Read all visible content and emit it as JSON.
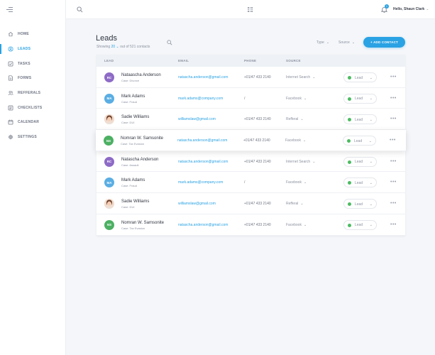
{
  "sidebar": {
    "items": [
      {
        "label": "HOME",
        "icon": "home-icon",
        "active": false
      },
      {
        "label": "LEADS",
        "icon": "user-circle-icon",
        "active": true
      },
      {
        "label": "TASKS",
        "icon": "checkbox-icon",
        "active": false
      },
      {
        "label": "FORMS",
        "icon": "document-icon",
        "active": false
      },
      {
        "label": "REFFERALS",
        "icon": "users-icon",
        "active": false
      },
      {
        "label": "CHECKLISTS",
        "icon": "checklist-icon",
        "active": false
      },
      {
        "label": "CALENDAR",
        "icon": "calendar-icon",
        "active": false
      },
      {
        "label": "SETTINGS",
        "icon": "gear-icon",
        "active": false
      }
    ]
  },
  "topbar": {
    "greeting": "Hello, Shaun Clark",
    "notification_count": "1"
  },
  "page": {
    "title": "Leads",
    "showing_label": "Showing",
    "per_page": "20",
    "total_text": "out of 521 contacts",
    "filters": [
      {
        "label": "Type"
      },
      {
        "label": "Source"
      }
    ],
    "add_contact_label": "+ ADD CONTACT"
  },
  "table": {
    "headers": [
      "LEAD",
      "EMAIL",
      "PHONE",
      "SOURCE"
    ],
    "rows": [
      {
        "initials": "RC",
        "avatar_color": "#8e6bc6",
        "name": "Nataascha Anderson",
        "case": "Case: Divorce",
        "email": "natascha.anderson@gmail.com",
        "phone": "+01/47 433 2140",
        "source": "Internet Search",
        "status": "Lead"
      },
      {
        "initials": "MA",
        "avatar_color": "#5aaee3",
        "name": "Mark Adams",
        "case": "Case: Fraud",
        "email": "mark.adams@company.com",
        "phone": "/",
        "source": "Facebook",
        "status": "Lead"
      },
      {
        "initials": "",
        "avatar_color": "#f3d9c6",
        "name": "Sadie Williams",
        "case": "Case: DUI",
        "email": "williamslaw@gmail.com",
        "phone": "+01/47 433 2140",
        "source": "Refferal",
        "status": "Lead",
        "photo": true
      },
      {
        "initials": "NS",
        "avatar_color": "#4cb063",
        "name": "Nomran W. Samsonite",
        "case": "Case: Tax Evasion",
        "email": "natascha.anderson@gmail.com",
        "phone": "+01/47 433 2140",
        "source": "Facebook",
        "status": "Lead"
      },
      {
        "initials": "RC",
        "avatar_color": "#8e6bc6",
        "name": "Natascha Anderson",
        "case": "Case: Assault",
        "email": "natascha.anderson@gmail.com",
        "phone": "+01/47 433 2140",
        "source": "Internet Search",
        "status": "Lead"
      },
      {
        "initials": "MA",
        "avatar_color": "#5aaee3",
        "name": "Mark Adams",
        "case": "Case: Fraud",
        "email": "mark.adams@company.com",
        "phone": "/",
        "source": "Facebook",
        "status": "Lead"
      },
      {
        "initials": "",
        "avatar_color": "#f3d9c6",
        "name": "Sadie Williams",
        "case": "Case: DUI",
        "email": "williamslaw@gmail.com",
        "phone": "+01/47 433 2140",
        "source": "Refferal",
        "status": "Lead",
        "photo": true
      },
      {
        "initials": "NS",
        "avatar_color": "#4cb063",
        "name": "Nomran W. Samsonite",
        "case": "Case: Tax Evasion",
        "email": "natascha.anderson@gmail.com",
        "phone": "+01/47 433 2140",
        "source": "Facebook",
        "status": "Lead"
      }
    ]
  },
  "colors": {
    "accent": "#2aa2e3",
    "status_green": "#4cbb62"
  }
}
